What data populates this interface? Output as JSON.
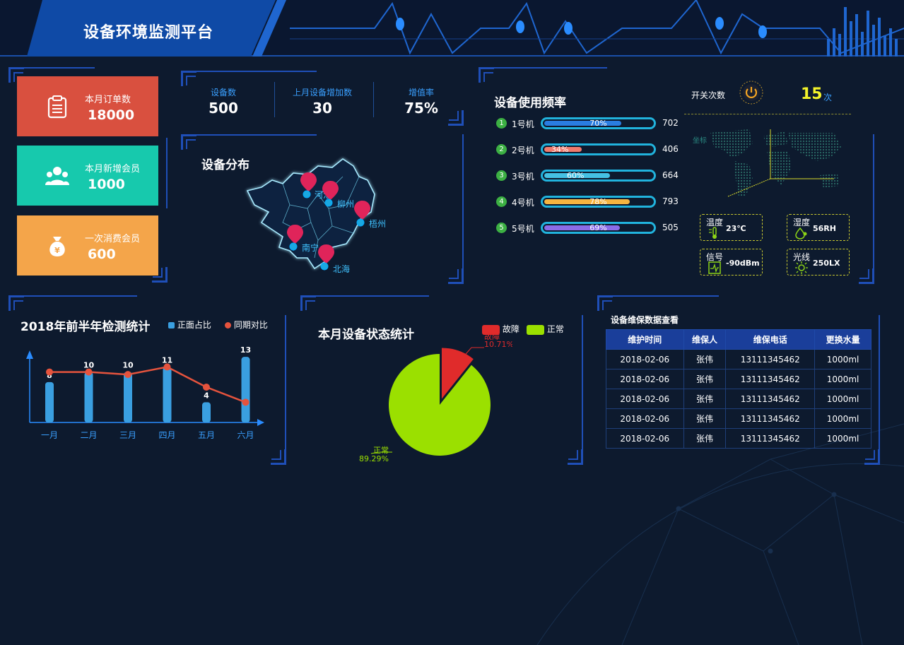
{
  "header": {
    "title": "设备环境监测平台"
  },
  "stat_cards": [
    {
      "label": "本月订单数",
      "value": "18000",
      "color": "#d9503f",
      "icon": "clipboard-icon"
    },
    {
      "label": "本月新增会员",
      "value": "1000",
      "color": "#17c9ad",
      "icon": "users-icon"
    },
    {
      "label": "一次消费会员",
      "value": "600",
      "color": "#f4a54a",
      "icon": "money-bag-icon"
    }
  ],
  "kpis": [
    {
      "label": "设备数",
      "value": "500"
    },
    {
      "label": "上月设备增加数",
      "value": "30"
    },
    {
      "label": "增值率",
      "value": "75%"
    }
  ],
  "distribution": {
    "title": "设备分布",
    "cities": [
      "河池",
      "柳州",
      "梧州",
      "南宁",
      "北海"
    ]
  },
  "usage": {
    "title": "设备使用频率",
    "machines": [
      {
        "index": "1",
        "name": "1号机",
        "percent": 70,
        "percent_label": "70%",
        "total": "702",
        "color": "#2a7de1"
      },
      {
        "index": "2",
        "name": "2号机",
        "percent": 34,
        "percent_label": "34%",
        "total": "406",
        "color": "#f07b6d"
      },
      {
        "index": "3",
        "name": "3号机",
        "percent": 60,
        "percent_label": "60%",
        "total": "664",
        "color": "#45c1e3"
      },
      {
        "index": "4",
        "name": "4号机",
        "percent": 78,
        "percent_label": "78%",
        "total": "793",
        "color": "#f5b440"
      },
      {
        "index": "5",
        "name": "5号机",
        "percent": 69,
        "percent_label": "69%",
        "total": "505",
        "color": "#8a6ce8"
      }
    ]
  },
  "switch": {
    "label": "开关次数",
    "value": "15",
    "unit": "次"
  },
  "world_map": {
    "axis_label": "坐标"
  },
  "sensors": [
    {
      "label": "温度",
      "value": "23℃",
      "icon": "thermometer-icon"
    },
    {
      "label": "湿度",
      "value": "56RH",
      "icon": "droplet-icon"
    },
    {
      "label": "信号",
      "value": "-90dBm",
      "icon": "signal-icon"
    },
    {
      "label": "光线",
      "value": "250LX",
      "icon": "sun-icon"
    }
  ],
  "half_year": {
    "chart_data": {
      "type": "bar",
      "title": "2018年前半年检测统计",
      "categories": [
        "一月",
        "二月",
        "三月",
        "四月",
        "五月",
        "六月"
      ],
      "series": [
        {
          "name": "正面占比",
          "type": "bar",
          "values": [
            8,
            10,
            10,
            11,
            4,
            13
          ],
          "color": "#3a9fe0"
        },
        {
          "name": "同期对比",
          "type": "line",
          "values": [
            10,
            10,
            9.5,
            11,
            7,
            4
          ],
          "color": "#e5533d"
        }
      ],
      "data_labels": [
        "8",
        "10",
        "10",
        "11",
        "4",
        "13"
      ],
      "ylim": [
        0,
        14
      ],
      "grid": false,
      "legend": "top-right"
    }
  },
  "status": {
    "chart_data": {
      "type": "pie",
      "title": "本月设备状态统计",
      "slices": [
        {
          "name": "故障",
          "value": 10.71,
          "label": "10.71%",
          "color": "#e02b2b"
        },
        {
          "name": "正常",
          "value": 89.29,
          "label": "89.29%",
          "color": "#9be000"
        }
      ],
      "legend": "top-right"
    }
  },
  "maintenance": {
    "title": "设备维保数据查看",
    "columns": [
      "维护时间",
      "维保人",
      "维保电话",
      "更换水量"
    ],
    "rows": [
      [
        "2018-02-06",
        "张伟",
        "13111345462",
        "1000ml"
      ],
      [
        "2018-02-06",
        "张伟",
        "13111345462",
        "1000ml"
      ],
      [
        "2018-02-06",
        "张伟",
        "13111345462",
        "1000ml"
      ],
      [
        "2018-02-06",
        "张伟",
        "13111345462",
        "1000ml"
      ],
      [
        "2018-02-06",
        "张伟",
        "13111345462",
        "1000ml"
      ]
    ]
  }
}
